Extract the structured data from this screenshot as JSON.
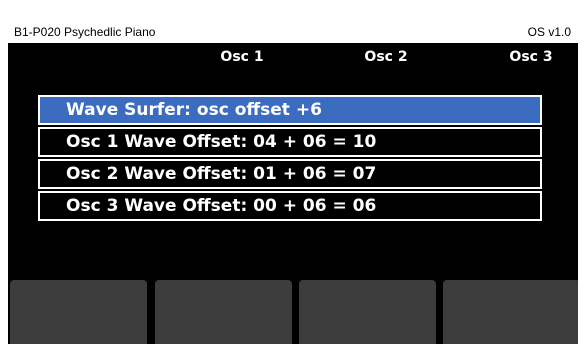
{
  "header": {
    "patch_name": "B1-P020 Psychedlic Piano",
    "os_version": "OS v1.0"
  },
  "softkey_labels": [
    "",
    "Osc 1",
    "Osc 2",
    "Osc 3"
  ],
  "menu": {
    "items": [
      {
        "label": "Wave Surfer: osc offset +6",
        "selected": true
      },
      {
        "label": "Osc 1 Wave Offset: 04 + 06 = 10",
        "selected": false
      },
      {
        "label": "Osc 2 Wave Offset: 01 + 06 = 07",
        "selected": false
      },
      {
        "label": "Osc 3 Wave Offset: 00 + 06 = 06",
        "selected": false
      }
    ]
  },
  "colors": {
    "screen_bg": "#000000",
    "selection": "#3c6cc0",
    "softkey": "#3c3c3c",
    "title_bar": "#ffffff"
  }
}
